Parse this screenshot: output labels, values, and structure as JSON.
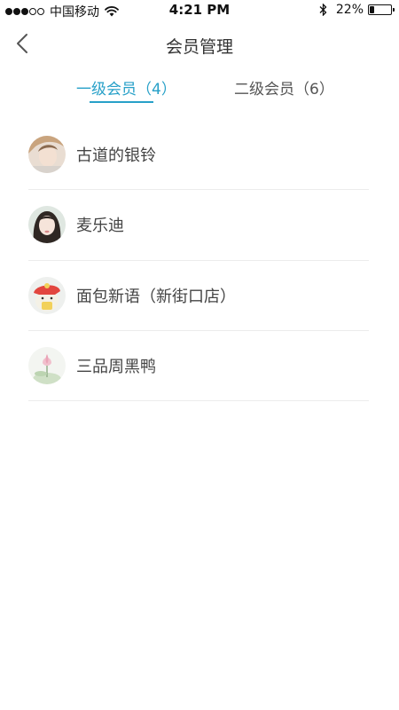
{
  "status_bar": {
    "carrier": "中国移动",
    "time": "4:21 PM",
    "battery_percent": "22%",
    "battery_level": 0.22,
    "signal_bars_filled": 3,
    "signal_bars_total": 5
  },
  "header": {
    "title": "会员管理",
    "back_icon": "chevron-left-icon"
  },
  "tabs": [
    {
      "label": "一级会员（4）",
      "active": true
    },
    {
      "label": "二级会员（6）",
      "active": false
    }
  ],
  "members": [
    {
      "name": "古道的银铃",
      "avatar": "avatar-photo-1"
    },
    {
      "name": "麦乐迪",
      "avatar": "avatar-photo-2"
    },
    {
      "name": "面包新语（新街口店）",
      "avatar": "avatar-photo-3"
    },
    {
      "name": "三品周黑鸭",
      "avatar": "avatar-photo-4"
    }
  ],
  "colors": {
    "accent": "#27a0c8",
    "divider": "#ececec",
    "text": "#444444"
  }
}
